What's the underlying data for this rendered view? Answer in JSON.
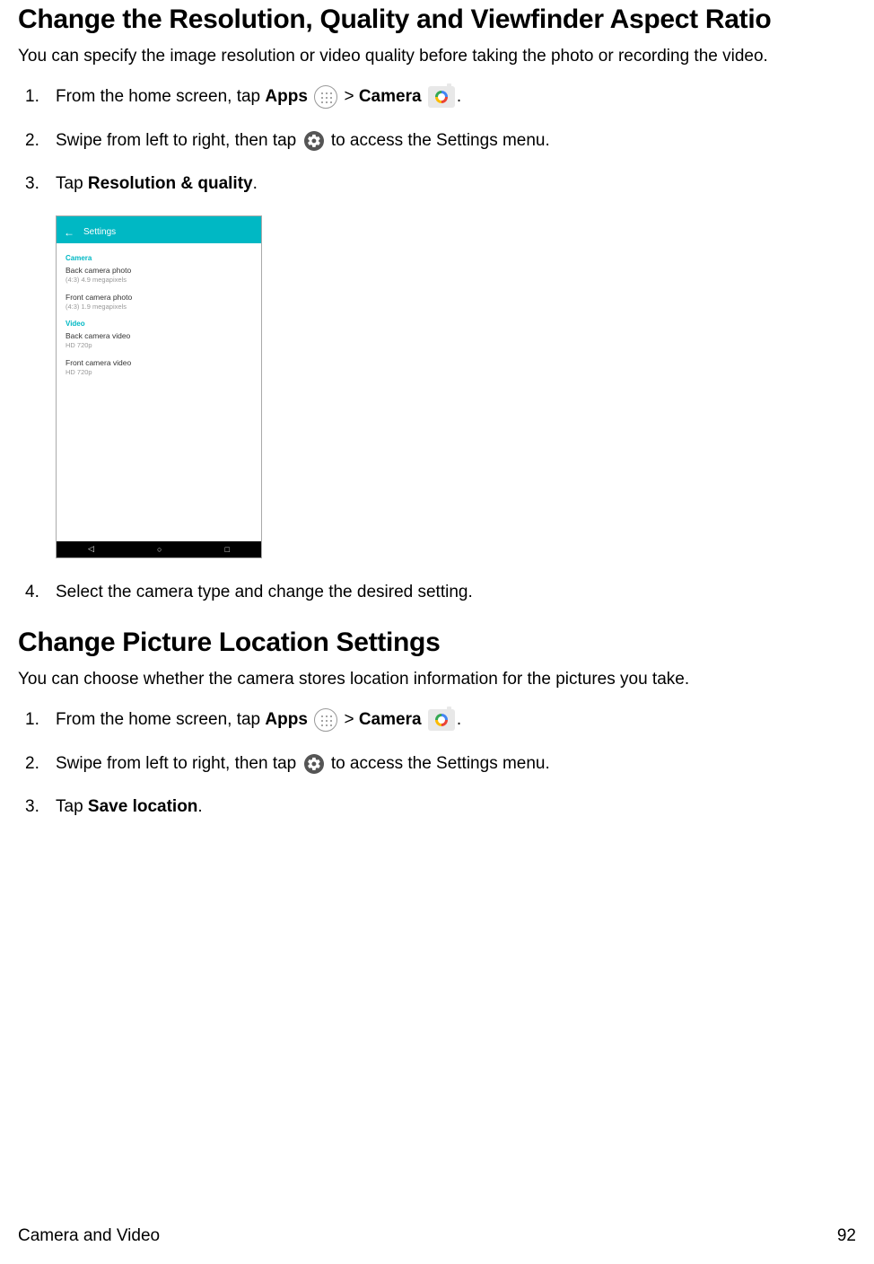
{
  "section1": {
    "heading": "Change the Resolution, Quality and Viewfinder Aspect Ratio",
    "intro": "You can specify the image resolution or video quality before taking the photo or recording the video.",
    "steps": {
      "s1a": "From the home screen, tap ",
      "s1_apps": "Apps",
      "s1b": " > ",
      "s1_camera": "Camera",
      "s1c": ".",
      "s2a": "Swipe from left to right, then tap ",
      "s2b": " to access the Settings menu.",
      "s3a": "Tap ",
      "s3_bold": "Resolution & quality",
      "s3b": ".",
      "s4": "Select the camera type and change the desired setting."
    }
  },
  "screenshot": {
    "title": "Settings",
    "camera_head": "Camera",
    "r1t": "Back camera photo",
    "r1s": "(4:3) 4.9 megapixels",
    "r2t": "Front camera photo",
    "r2s": "(4:3) 1.9 megapixels",
    "video_head": "Video",
    "r3t": "Back camera video",
    "r3s": "HD 720p",
    "r4t": "Front camera video",
    "r4s": "HD 720p"
  },
  "section2": {
    "heading": "Change Picture Location Settings",
    "intro": "You can choose whether the camera stores location information for the pictures you take.",
    "steps": {
      "s1a": "From the home screen, tap ",
      "s1_apps": "Apps",
      "s1b": " > ",
      "s1_camera": "Camera",
      "s1c": ".",
      "s2a": "Swipe from left to right, then tap ",
      "s2b": " to access the Settings menu.",
      "s3a": "Tap ",
      "s3_bold": "Save location",
      "s3b": "."
    }
  },
  "footer": {
    "left": "Camera and Video",
    "right": "92"
  }
}
